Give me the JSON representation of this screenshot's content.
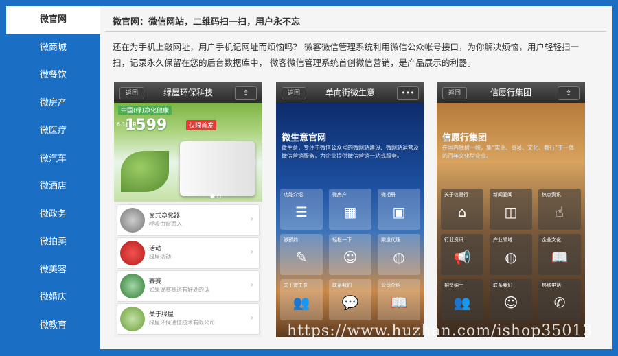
{
  "sidebar": {
    "items": [
      {
        "label": "微官网",
        "active": true
      },
      {
        "label": "微商城"
      },
      {
        "label": "微餐饮"
      },
      {
        "label": "微房产"
      },
      {
        "label": "微医疗"
      },
      {
        "label": "微汽车"
      },
      {
        "label": "微酒店"
      },
      {
        "label": "微政务"
      },
      {
        "label": "微拍卖"
      },
      {
        "label": "微美容"
      },
      {
        "label": "微婚庆"
      },
      {
        "label": "微教育"
      }
    ]
  },
  "main": {
    "title": "微官网：微信网站，二维码扫一扫，用户永不忘",
    "desc": "还在为手机上敲网址，用户手机记网址而烦恼吗？ 微客微信管理系统利用微信公众帐号接口，为你解决烦恼，用户轻轻扫一扫，记录永久保留在您的后台数据库中， 微客微信管理系统首创微信营销，是产品展示的利器。"
  },
  "phone1": {
    "back": "返回",
    "title": "绿屋环保科技",
    "banner_top": "中国(绿)净化健康",
    "banner_rmb": "6.1折 RMB",
    "banner_price": "1599",
    "banner_promo": "仅限首发",
    "items": [
      {
        "title": "窗式净化器",
        "sub": "呼吸由窗而入"
      },
      {
        "title": "活动",
        "sub": "绿屋活动"
      },
      {
        "title": "賽賽",
        "sub": "如果说赛赛还有好处的话"
      },
      {
        "title": "关于绿屋",
        "sub": "绿屋环保通信技术有限公司"
      }
    ]
  },
  "phone2": {
    "back": "返回",
    "title": "单向街微生意",
    "heading": "微生意官网",
    "sub": "微生意，专注于微信公众号的微网站建设、微网站运营及微信营销服务，为企业提供微信营销一站式服务。",
    "cells": [
      "功能介绍",
      "微房产",
      "微相册",
      "微预约",
      "轻松一下",
      "渠道代理",
      "关于微生意",
      "联系我们",
      "公司介绍"
    ]
  },
  "phone3": {
    "back": "返回",
    "title": "信愿行集团",
    "heading": "信愿行集团",
    "sub": "在国内独树一帜，集“实业、贸易、文化、教行”于一体的百年文化型企业。",
    "cells": [
      "关于信愿行",
      "新闻要闻",
      "热点资讯",
      "行业资讯",
      "产业领域",
      "企业文化",
      "招贤纳士",
      "联系我们",
      "热线电话"
    ]
  },
  "watermark": "https://www.huzhan.com/ishop35013"
}
